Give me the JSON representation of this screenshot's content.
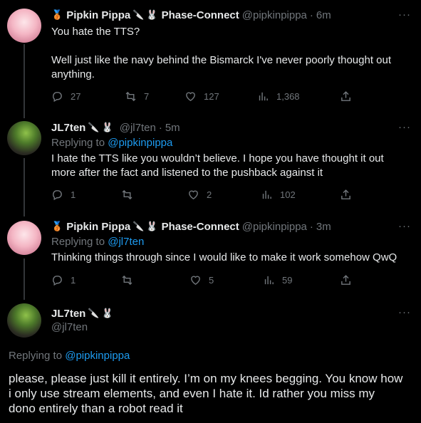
{
  "tweets": [
    {
      "name": "Pipkin Pippa",
      "affiliation": "Phase-Connect",
      "handle": "@pipkinpippa",
      "time": "6m",
      "text_lines": [
        "You hate the TTS?",
        "",
        "Well just like the navy behind the Bismarck I've never poorly thought out",
        "anything."
      ],
      "replies": "27",
      "retweets": "7",
      "likes": "127",
      "views": "1,368"
    },
    {
      "name": "JL7ten",
      "handle": "@jl7ten",
      "time": "5m",
      "replying_label": "Replying to",
      "replying_to": "@pipkinpippa",
      "text_lines": [
        "I hate the TTS like you wouldn’t believe. I hope you have thought it out",
        "more after the fact and listened to the pushback against it"
      ],
      "replies": "1",
      "retweets": "",
      "likes": "2",
      "views": "102"
    },
    {
      "name": "Pipkin Pippa",
      "affiliation": "Phase-Connect",
      "handle": "@pipkinpippa",
      "time": "3m",
      "replying_label": "Replying to",
      "replying_to": "@jl7ten",
      "text_lines": [
        "Thinking things through since I would like to make it work somehow QwQ"
      ],
      "replies": "1",
      "retweets": "",
      "likes": "5",
      "views": "59"
    }
  ],
  "main": {
    "name": "JL7ten",
    "handle": "@jl7ten",
    "replying_label": "Replying to",
    "replying_to": "@pipkinpippa",
    "text_lines": [
      "please, please just kill it entirely. I’m on my knees begging. You know how",
      "i only use stream elements, and even I hate it. Id rather you miss my",
      "dono entirely than a robot read it"
    ]
  },
  "more_label": "···",
  "handle_time_sep": "·"
}
